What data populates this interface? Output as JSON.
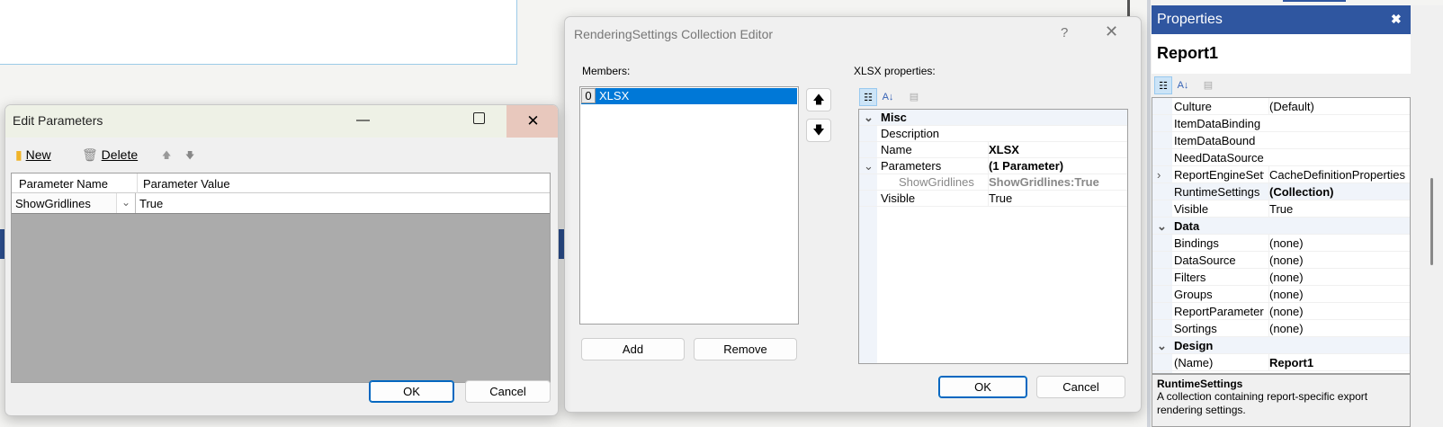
{
  "edit_parameters": {
    "title": "Edit Parameters",
    "toolbar": {
      "new_label": "New",
      "delete_label": "Delete"
    },
    "columns": [
      "Parameter Name",
      "Parameter Value"
    ],
    "rows": [
      {
        "name": "ShowGridlines",
        "value": "True"
      }
    ],
    "ok_label": "OK",
    "cancel_label": "Cancel"
  },
  "collection_editor": {
    "title": "RenderingSettings Collection Editor",
    "help": "?",
    "members_label": "Members:",
    "members": [
      {
        "index": "0",
        "name": "XLSX"
      }
    ],
    "add_label": "Add",
    "remove_label": "Remove",
    "properties_label": "XLSX properties:",
    "grid": [
      {
        "type": "category",
        "name": "Misc"
      },
      {
        "name": "Description",
        "value": ""
      },
      {
        "name": "Name",
        "value": "XLSX",
        "bold": true
      },
      {
        "name": "Parameters",
        "value": "(1 Parameter)",
        "bold": true,
        "expanded": true
      },
      {
        "name": "ShowGridlines",
        "value": "ShowGridlines:True",
        "child": true
      },
      {
        "name": "Visible",
        "value": "True"
      }
    ],
    "ok_label": "OK",
    "cancel_label": "Cancel"
  },
  "properties_panel": {
    "title": "Properties",
    "object": "Report1",
    "grid": [
      {
        "name": "Culture",
        "value": "(Default)"
      },
      {
        "name": "ItemDataBinding",
        "value": ""
      },
      {
        "name": "ItemDataBound",
        "value": ""
      },
      {
        "name": "NeedDataSource",
        "value": ""
      },
      {
        "name": "ReportEngineSettings",
        "value": "CacheDefinitionProperties",
        "expandable": true
      },
      {
        "name": "RuntimeSettings",
        "value": "(Collection)",
        "bold": true,
        "selected": true
      },
      {
        "name": "Visible",
        "value": "True"
      },
      {
        "type": "category",
        "name": "Data"
      },
      {
        "name": "Bindings",
        "value": "(none)"
      },
      {
        "name": "DataSource",
        "value": "(none)"
      },
      {
        "name": "Filters",
        "value": "(none)"
      },
      {
        "name": "Groups",
        "value": "(none)"
      },
      {
        "name": "ReportParameters",
        "value": "(none)"
      },
      {
        "name": "Sortings",
        "value": "(none)"
      },
      {
        "type": "category",
        "name": "Design"
      },
      {
        "name": "(Name)",
        "value": "Report1",
        "bold": true
      }
    ],
    "description_title": "RuntimeSettings",
    "description_text": "A collection containing report-specific export rendering settings."
  },
  "colors": {
    "accent": "#2f56a0",
    "selection": "#0078d7",
    "close_hover": "#e8c8bd"
  }
}
